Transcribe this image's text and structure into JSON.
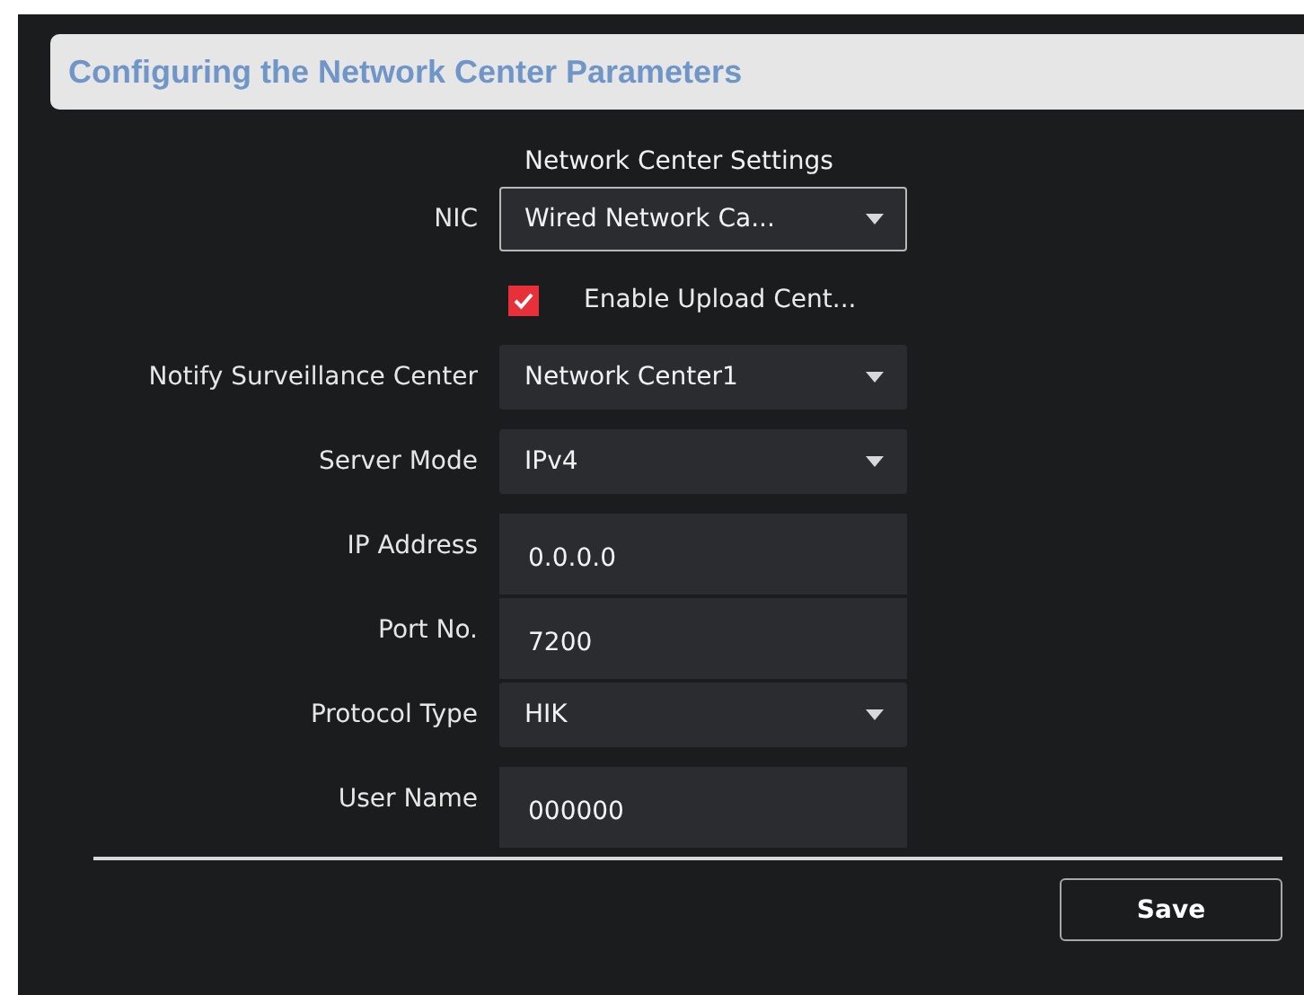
{
  "title": "Configuring the Network Center Parameters",
  "section_title": "Network Center Settings",
  "fields": [
    {
      "kind": "select",
      "label": "NIC",
      "value": "Wired Network Ca...",
      "focused": true
    },
    {
      "kind": "checkbox",
      "text": "Enable Upload Cent...",
      "checked": true
    },
    {
      "kind": "select",
      "label": "Notify Surveillance Center",
      "value": "Network Center1",
      "focused": false
    },
    {
      "kind": "select",
      "label": "Server Mode",
      "value": "IPv4",
      "focused": false
    },
    {
      "kind": "input",
      "label": "IP Address",
      "value": "0.0.0.0"
    },
    {
      "kind": "input",
      "label": "Port No.",
      "value": "7200"
    },
    {
      "kind": "select",
      "label": "Protocol Type",
      "value": "HIK",
      "focused": false
    },
    {
      "kind": "input",
      "label": "User Name",
      "value": "000000"
    }
  ],
  "save_button": "Save"
}
